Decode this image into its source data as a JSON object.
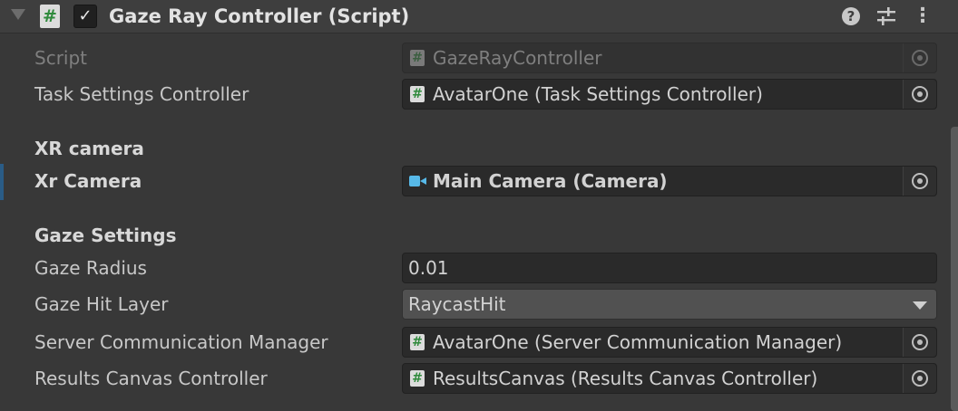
{
  "header": {
    "title": "Gaze Ray Controller (Script)",
    "script_glyph": "#",
    "check_glyph": "✓",
    "help_glyph": "?",
    "presets_glyph": "⚟",
    "menu_glyph": "⋮",
    "enabled": true
  },
  "rows": {
    "script": {
      "label": "Script",
      "value": "GazeRayController"
    },
    "task_settings": {
      "label": "Task Settings Controller",
      "value": "AvatarOne (Task Settings Controller)"
    },
    "xr_header": "XR camera",
    "xr_camera": {
      "label": "Xr Camera",
      "value": "Main Camera (Camera)"
    },
    "gaze_header": "Gaze Settings",
    "gaze_radius": {
      "label": "Gaze Radius",
      "value": "0.01"
    },
    "gaze_hit_layer": {
      "label": "Gaze Hit Layer",
      "value": "RaycastHit"
    },
    "server_comm": {
      "label": "Server Communication Manager",
      "value": "AvatarOne (Server Communication Manager)"
    },
    "results_canvas": {
      "label": "Results Canvas Controller",
      "value": "ResultsCanvas (Results Canvas Controller)"
    }
  },
  "icon_glyph": "#",
  "colors": {
    "background": "#383838",
    "header": "#3e3e3e",
    "field": "#2a2a2a",
    "script_icon_green": "#2f8a3c",
    "camera_icon_blue": "#57b9e8",
    "selection_marker": "#2a5c86"
  }
}
